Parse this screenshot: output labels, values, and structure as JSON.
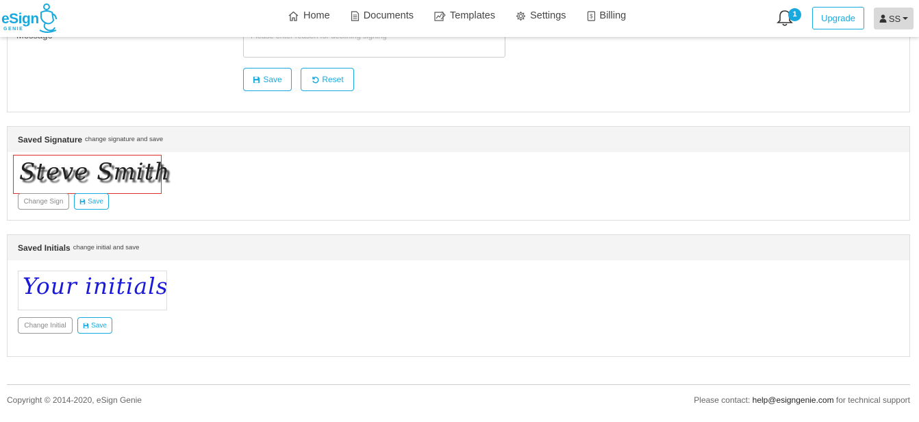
{
  "brand": {
    "name": "eSign",
    "sub": "GENIE",
    "color": "#1aa9de"
  },
  "nav": {
    "items": [
      {
        "label": "Home",
        "icon": "home-icon"
      },
      {
        "label": "Documents",
        "icon": "document-icon"
      },
      {
        "label": "Templates",
        "icon": "templates-icon"
      },
      {
        "label": "Settings",
        "icon": "gear-icon"
      },
      {
        "label": "Billing",
        "icon": "billing-icon"
      }
    ],
    "notifications_count": "1",
    "upgrade_label": "Upgrade",
    "user_initials": "SS"
  },
  "message_form": {
    "label": "Message",
    "placeholder": "Please enter reason for declining signing",
    "save_label": "Save",
    "reset_label": "Reset"
  },
  "saved_signature": {
    "title": "Saved Signature",
    "subtitle": "change signature and save",
    "signature_text": "Steve Smith",
    "change_label": "Change Sign",
    "save_label": "Save"
  },
  "saved_initials": {
    "title": "Saved Initials",
    "subtitle": "change initial and save",
    "initials_text": "Your initials",
    "change_label": "Change Initial",
    "save_label": "Save"
  },
  "footer": {
    "copyright": "Copyright © 2014-2020, eSign Genie",
    "contact_prefix": "Please contact: ",
    "contact_email": "help@esigngenie.com",
    "contact_suffix": " for technical support"
  }
}
